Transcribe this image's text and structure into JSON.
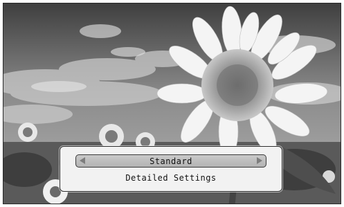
{
  "menu": {
    "mode_value": "Standard",
    "detailed_settings_label": "Detailed Settings"
  },
  "icons": {
    "prev": "arrow-left-icon",
    "next": "arrow-right-icon"
  }
}
